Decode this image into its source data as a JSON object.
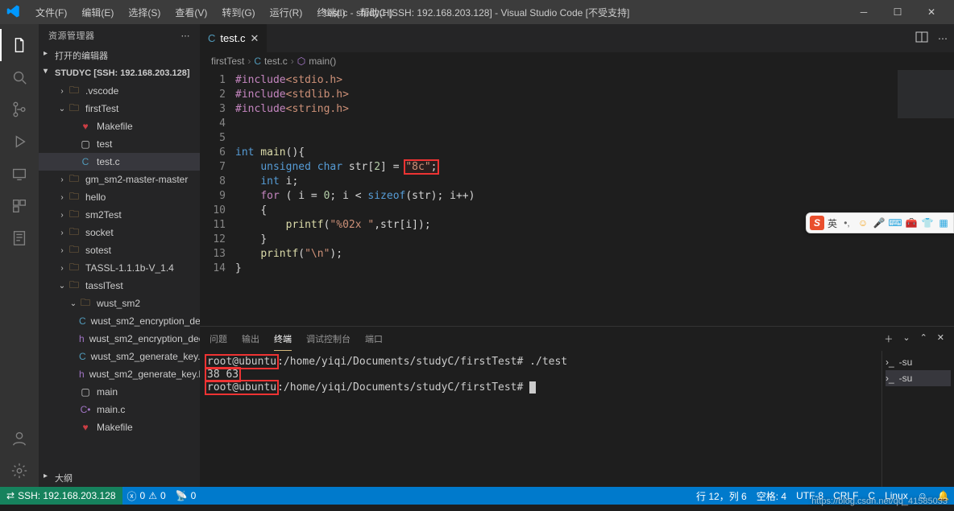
{
  "titlebar": {
    "menus": [
      "文件(F)",
      "编辑(E)",
      "选择(S)",
      "查看(V)",
      "转到(G)",
      "运行(R)",
      "终端(I)",
      "帮助(H)"
    ],
    "title": "test.c - studyC [SSH: 192.168.203.128] - Visual Studio Code [不受支持]"
  },
  "sidebar": {
    "title": "资源管理器",
    "openEditors": "打开的编辑器",
    "rootLabel": "STUDYC [SSH: 192.168.203.128]",
    "tree": [
      {
        "depth": 1,
        "twist": ">",
        "icon": "folder",
        "label": ".vscode"
      },
      {
        "depth": 1,
        "twist": "v",
        "icon": "folder",
        "label": "firstTest",
        "open": true
      },
      {
        "depth": 2,
        "twist": "",
        "icon": "make",
        "label": "Makefile"
      },
      {
        "depth": 2,
        "twist": "",
        "icon": "gen",
        "label": "test"
      },
      {
        "depth": 2,
        "twist": "",
        "icon": "c",
        "label": "test.c",
        "selected": true
      },
      {
        "depth": 1,
        "twist": ">",
        "icon": "folder",
        "label": "gm_sm2-master-master"
      },
      {
        "depth": 1,
        "twist": ">",
        "icon": "folder",
        "label": "hello"
      },
      {
        "depth": 1,
        "twist": ">",
        "icon": "folder",
        "label": "sm2Test"
      },
      {
        "depth": 1,
        "twist": ">",
        "icon": "folder",
        "label": "socket"
      },
      {
        "depth": 1,
        "twist": ">",
        "icon": "folder",
        "label": "sotest"
      },
      {
        "depth": 1,
        "twist": ">",
        "icon": "folder",
        "label": "TASSL-1.1.1b-V_1.4"
      },
      {
        "depth": 1,
        "twist": "v",
        "icon": "folder",
        "label": "tasslTest",
        "open": true
      },
      {
        "depth": 2,
        "twist": "v",
        "icon": "folder",
        "label": "wust_sm2",
        "open": true
      },
      {
        "depth": 3,
        "twist": "",
        "icon": "c",
        "label": "wust_sm2_encryption_decryption.c"
      },
      {
        "depth": 3,
        "twist": "",
        "icon": "h",
        "label": "wust_sm2_encryption_decryption.h"
      },
      {
        "depth": 3,
        "twist": "",
        "icon": "c",
        "label": "wust_sm2_generate_key.c"
      },
      {
        "depth": 3,
        "twist": "",
        "icon": "h",
        "label": "wust_sm2_generate_key.h"
      },
      {
        "depth": 2,
        "twist": "",
        "icon": "gen",
        "label": "main"
      },
      {
        "depth": 2,
        "twist": "",
        "icon": "cbrace",
        "label": "main.c"
      },
      {
        "depth": 2,
        "twist": "",
        "icon": "make",
        "label": "Makefile"
      }
    ],
    "outline": "大纲"
  },
  "tabs": {
    "file": "test.c"
  },
  "breadcrumb": {
    "a": "firstTest",
    "b": "test.c",
    "c": "main()"
  },
  "gutter": [
    "1",
    "2",
    "3",
    "4",
    "5",
    "6",
    "7",
    "8",
    "9",
    "10",
    "11",
    "12",
    "13",
    "14"
  ],
  "code": {
    "l1a": "#include",
    "l1b": "<stdio.h>",
    "l2a": "#include",
    "l2b": "<stdlib.h>",
    "l3a": "#include",
    "l3b": "<string.h>",
    "l6a": "int",
    "l6b": " main",
    "l6c": "(){",
    "l7a": "unsigned",
    "l7b": " char",
    "l7c": " str[",
    "l7d": "2",
    "l7e": "] = ",
    "l7f": "\"8c\"",
    "l7g": ";",
    "l8a": "int",
    "l8b": " i;",
    "l9a": "for",
    "l9b": " ( i = ",
    "l9c": "0",
    "l9d": "; i < ",
    "l9e": "sizeof",
    "l9f": "(str); i++)",
    "l10": "{",
    "l11a": "printf",
    "l11b": "(",
    "l11c": "\"%02x \"",
    "l11d": ",str[i]);",
    "l12": "}",
    "l13a": "printf",
    "l13b": "(",
    "l13c": "\"\\n\"",
    "l13d": ");",
    "l14": "}"
  },
  "panel": {
    "tabs": [
      "问题",
      "输出",
      "终端",
      "调试控制台",
      "端口"
    ],
    "activeIndex": 2,
    "term_side": [
      "-su",
      "-su"
    ],
    "terminal": {
      "line1a": "root@ubuntu",
      "line1b": ":/home/yiqi/Documents/studyC/firstTest# ./test",
      "line2": "38 63 ",
      "line3a": "root@ubuntu",
      "line3b": ":/home/yiqi/Documents/studyC/firstTest# "
    }
  },
  "status": {
    "remote": "SSH: 192.168.203.128",
    "errs": "0",
    "warns": "0",
    "ports": "0",
    "lncol": "行 12，列 6",
    "spaces": "空格: 4",
    "enc": "UTF-8",
    "eol": "CRLF",
    "lang": "C",
    "os": "Linux"
  },
  "ime": {
    "label": "英"
  },
  "watermark": "https://blog.csdn.net/qq_41585033"
}
